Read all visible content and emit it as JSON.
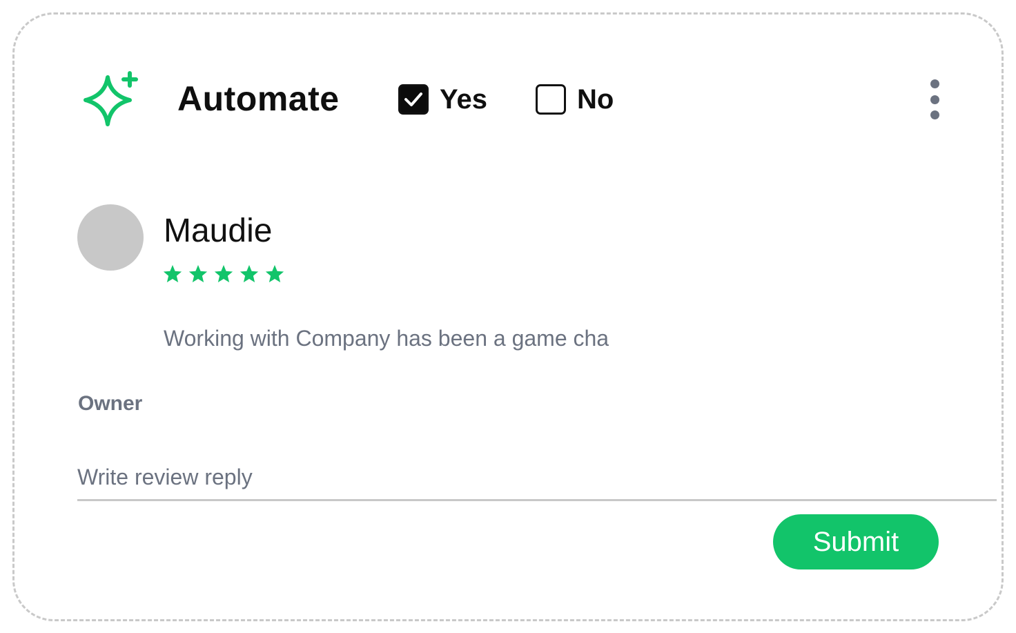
{
  "header": {
    "title": "Automate",
    "icon": "sparkle-icon",
    "accent_color": "#12C46A",
    "options": [
      {
        "label": "Yes",
        "checked": true
      },
      {
        "label": "No",
        "checked": false
      }
    ],
    "menu_icon": "more-vertical-icon"
  },
  "review": {
    "reviewer_name": "Maudie",
    "rating": 5,
    "rating_max": 5,
    "star_color": "#12C46A",
    "text": "Working with Company has been a game cha"
  },
  "reply": {
    "section_label": "Owner",
    "placeholder": "Write review reply",
    "value": "",
    "submit_label": "Submit",
    "submit_color": "#12C46A"
  }
}
